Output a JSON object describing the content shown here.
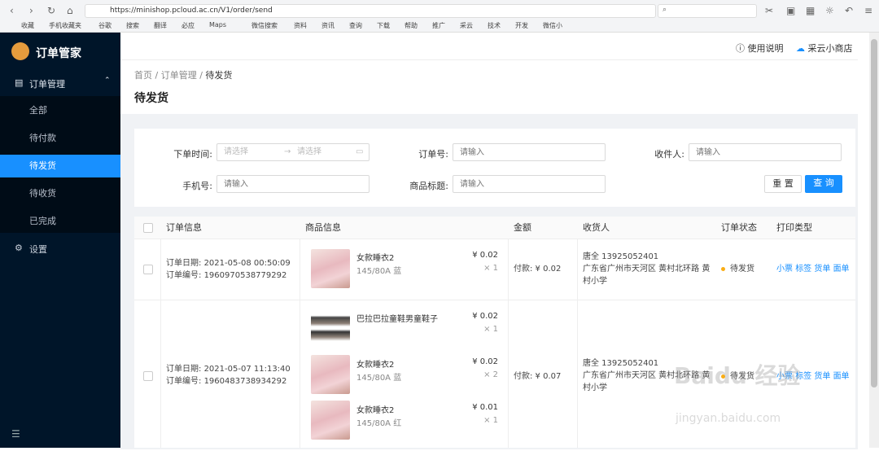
{
  "browser": {
    "url": "https://minishop.pcloud.ac.cn/V1/order/send",
    "bookmarks": [
      "收藏",
      "手机收藏夹",
      "谷歌",
      "搜索",
      "翻译",
      "必应",
      "Maps",
      "微信搜索",
      "资料",
      "资讯",
      "查询",
      "下载",
      "帮助",
      "推广",
      "采云",
      "技术",
      "开发",
      "微信小"
    ]
  },
  "sidebar": {
    "app_name": "订单管家",
    "order_menu_label": "订单管理",
    "items": [
      "全部",
      "待付款",
      "待发货",
      "待收货",
      "已完成"
    ],
    "active_index": 2,
    "settings_label": "设置"
  },
  "header": {
    "help_label": "使用说明",
    "shop_label": "采云小商店"
  },
  "breadcrumb": {
    "home": "首页",
    "order": "订单管理",
    "current": "待发货"
  },
  "page_title": "待发货",
  "filters": {
    "order_time_label": "下单时间:",
    "start_placeholder": "请选择",
    "end_placeholder": "请选择",
    "order_no_label": "订单号:",
    "order_no_placeholder": "请输入",
    "receiver_label": "收件人:",
    "receiver_placeholder": "请输入",
    "phone_label": "手机号:",
    "phone_placeholder": "请输入",
    "title_label": "商品标题:",
    "title_placeholder": "请输入",
    "reset_label": "重 置",
    "search_label": "查 询"
  },
  "table": {
    "headers": [
      "订单信息",
      "商品信息",
      "金额",
      "收货人",
      "订单状态",
      "打印类型"
    ],
    "orders": [
      {
        "date_label": "订单日期:",
        "date": "2021-05-08 00:50:09",
        "no_label": "订单编号:",
        "no": "1960970538779292",
        "products": [
          {
            "name": "女款睡衣2",
            "sku": "145/80A 蓝",
            "price": "¥ 0.02",
            "qty": "× 1"
          }
        ],
        "amount": "付款: ¥ 0.02",
        "receiver": "唐全 13925052401",
        "address": "广东省广州市天河区 黄村北环路 黄村小学",
        "status": "待发货",
        "print_links": [
          "小票",
          "标签",
          "货单",
          "面单"
        ]
      },
      {
        "date_label": "订单日期:",
        "date": "2021-05-07 11:13:40",
        "no_label": "订单编号:",
        "no": "1960483738934292",
        "products": [
          {
            "name": "巴拉巴拉童鞋男童鞋子",
            "sku": "",
            "price": "¥ 0.02",
            "qty": "× 1"
          },
          {
            "name": "女款睡衣2",
            "sku": "145/80A 蓝",
            "price": "¥ 0.02",
            "qty": "× 2"
          },
          {
            "name": "女款睡衣2",
            "sku": "145/80A 红",
            "price": "¥ 0.01",
            "qty": "× 1"
          }
        ],
        "amount": "付款: ¥ 0.07",
        "receiver": "唐全 13925052401",
        "address": "广东省广州市天河区 黄村北环路 黄村小学",
        "status": "待发货",
        "print_links": [
          "小票",
          "标签",
          "货单",
          "面单"
        ]
      }
    ]
  },
  "watermark": {
    "text": "Baidu 经验",
    "sub": "jingyan.baidu.com"
  }
}
